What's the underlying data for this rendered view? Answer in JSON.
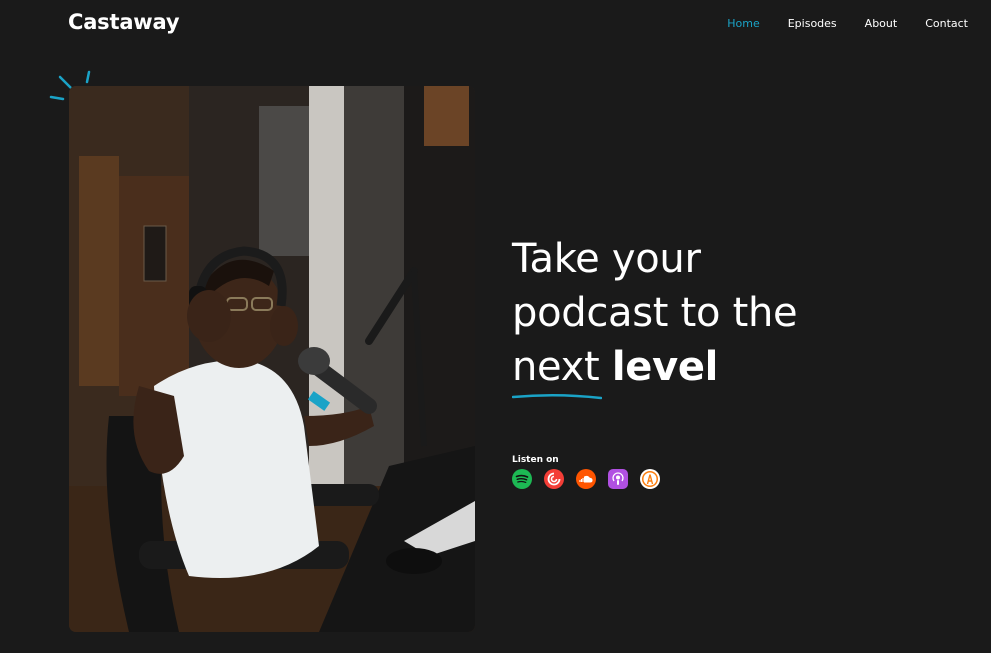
{
  "brand": {
    "name": "Castaway"
  },
  "nav": {
    "items": [
      {
        "label": "Home",
        "active": true
      },
      {
        "label": "Episodes",
        "active": false
      },
      {
        "label": "About",
        "active": false
      },
      {
        "label": "Contact",
        "active": false
      }
    ]
  },
  "hero": {
    "headline": {
      "line1": "Take your",
      "line2": "podcast to the",
      "line3_underlined": "next",
      "line3_bold": "level"
    },
    "listen_label": "Listen on",
    "platforms": [
      {
        "name": "spotify-icon",
        "color": "#1db954"
      },
      {
        "name": "pocketcasts-icon",
        "color": "#f43e37"
      },
      {
        "name": "soundcloud-icon",
        "color": "#ff5500"
      },
      {
        "name": "apple-podcasts-icon",
        "color": "#b150e2"
      },
      {
        "name": "overcast-icon",
        "color": "#fc7e0f"
      }
    ]
  },
  "colors": {
    "background": "#1a1a1a",
    "accent": "#1aa3c7",
    "text": "#ffffff"
  }
}
